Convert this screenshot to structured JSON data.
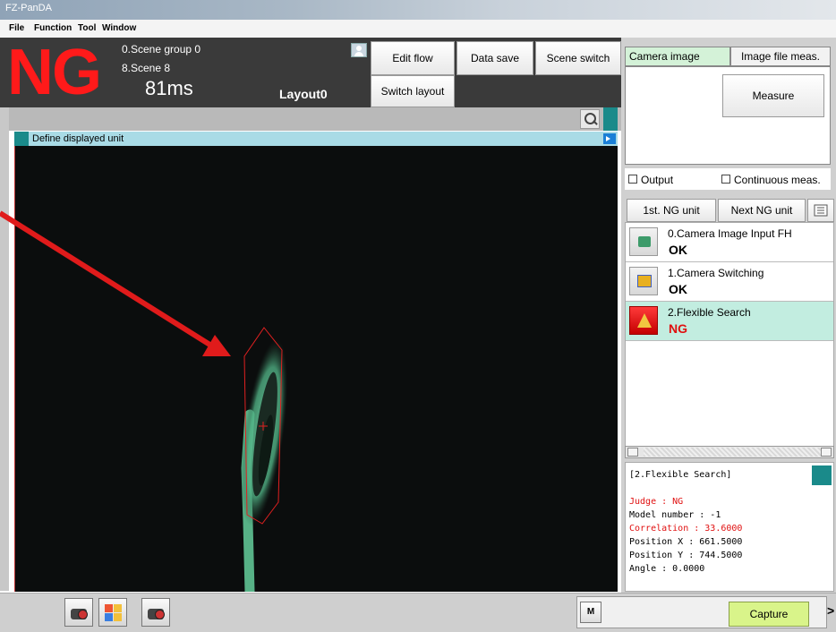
{
  "app_title": "FZ-PanDA",
  "menu": [
    "File",
    "Function",
    "Tool",
    "Window"
  ],
  "header": {
    "judgement": "NG",
    "scene_group": "0.Scene group 0",
    "scene": "8.Scene 8",
    "time": "81ms",
    "layout": "Layout0"
  },
  "toolbar": {
    "edit_flow": "Edit flow",
    "data_save": "Data save",
    "scene_switch": "Scene switch",
    "switch_layout": "Switch layout"
  },
  "image_window": {
    "title": "Define displayed unit"
  },
  "measure_panel": {
    "tab_camera": "Camera image meas.",
    "tab_file": "Image file meas.",
    "measure_button": "Measure",
    "output_label": "Output",
    "continuous_label": "Continuous meas."
  },
  "nav": {
    "first_ng": "1st. NG unit",
    "next_ng": "Next NG unit"
  },
  "units": [
    {
      "name": "0.Camera Image Input FH",
      "result": "OK"
    },
    {
      "name": "1.Camera Switching",
      "result": "OK"
    },
    {
      "name": "2.Flexible Search",
      "result": "NG"
    }
  ],
  "detail": {
    "title": "[2.Flexible Search]",
    "judge": "Judge : NG",
    "model_number": "Model number : -1",
    "correlation": "Correlation : 33.6000",
    "position_x": "Position X : 661.5000",
    "position_y": "Position Y : 744.5000",
    "angle": "Angle : 0.0000"
  },
  "bottom": {
    "m_label": "M",
    "capture": "Capture",
    "more": ">"
  },
  "colors": {
    "ng_red": "#ff1a1a",
    "teal": "#1a8a8a",
    "active_unit_bg": "#c2ede0",
    "capture_bg": "#d9f48a",
    "annotation_arrow": "#e01b1b"
  }
}
